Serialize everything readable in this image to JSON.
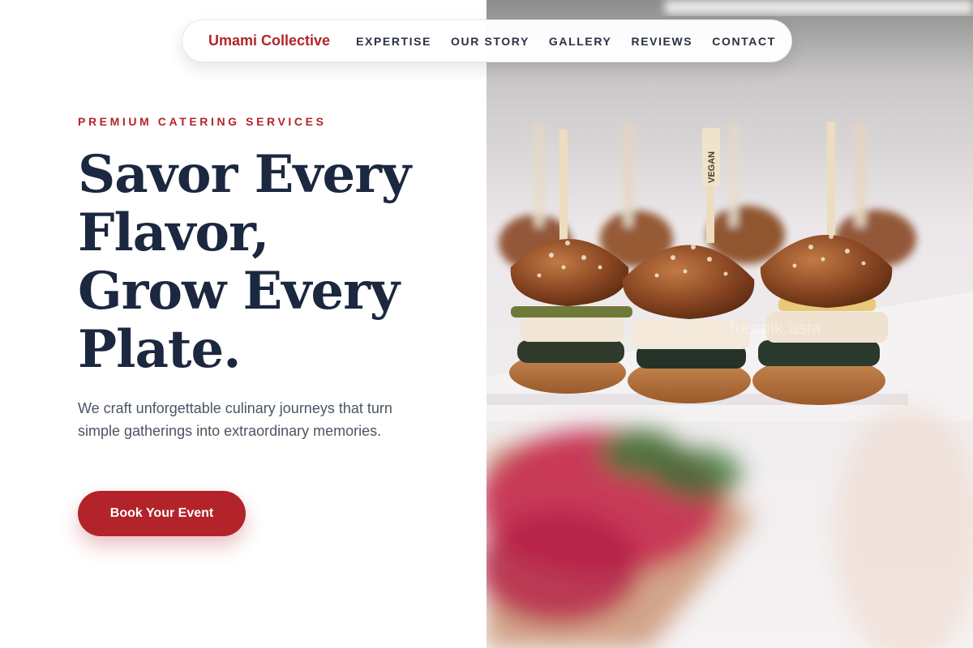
{
  "nav": {
    "brand": "Umami Collective",
    "links": [
      "EXPERTISE",
      "OUR STORY",
      "GALLERY",
      "REVIEWS",
      "CONTACT"
    ]
  },
  "hero": {
    "eyebrow": "PREMIUM CATERING SERVICES",
    "headline_lines": [
      "Savor Every",
      "Flavor,",
      "Grow Every",
      "Plate."
    ],
    "subcopy": "We craft unforgettable culinary journeys that turn simple gatherings into extraordinary memories.",
    "cta_label": "Book Your Event",
    "image_flag_text": "VEGAN",
    "image_watermark": "freepik.asia"
  },
  "colors": {
    "accent": "#b3242a",
    "heading": "#1c2740",
    "body_text": "#4b5563"
  }
}
